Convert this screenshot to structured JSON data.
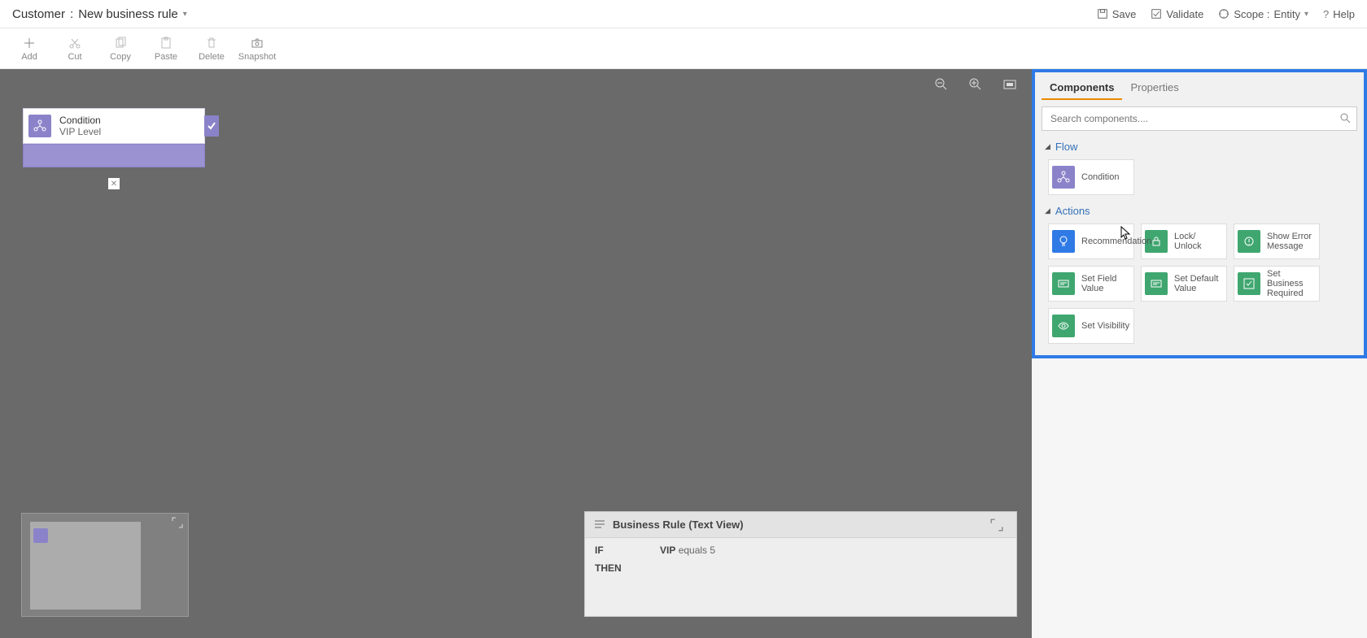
{
  "titlebar": {
    "entity": "Customer",
    "sep": ":",
    "rule_name": "New business rule",
    "save": "Save",
    "validate": "Validate",
    "scope_label": "Scope :",
    "scope_value": "Entity",
    "help": "Help"
  },
  "toolbar": {
    "add": "Add",
    "cut": "Cut",
    "copy": "Copy",
    "paste": "Paste",
    "delete": "Delete",
    "snapshot": "Snapshot"
  },
  "canvas": {
    "node": {
      "type": "Condition",
      "field": "VIP Level"
    }
  },
  "textview": {
    "title": "Business Rule (Text View)",
    "if": "IF",
    "then": "THEN",
    "cond_field": "VIP",
    "cond_op": "equals",
    "cond_val": "5"
  },
  "panel": {
    "tab_components": "Components",
    "tab_properties": "Properties",
    "search_placeholder": "Search components....",
    "section_flow": "Flow",
    "section_actions": "Actions",
    "flow": {
      "condition": "Condition"
    },
    "actions": {
      "recommendation": "Recommendation",
      "lock_unlock": "Lock/\nUnlock",
      "show_error": "Show Error Message",
      "set_field": "Set Field Value",
      "set_default": "Set Default Value",
      "set_required": "Set Business Required",
      "set_visibility": "Set Visibility"
    }
  }
}
